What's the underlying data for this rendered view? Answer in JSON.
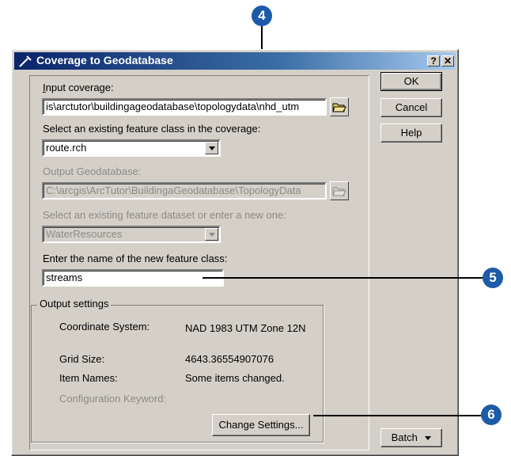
{
  "callouts": {
    "c4": "4",
    "c5": "5",
    "c6": "6"
  },
  "window": {
    "title": "Coverage to Geodatabase",
    "help_btn": "?",
    "close_btn": "✕"
  },
  "form": {
    "input_coverage_label_first": "I",
    "input_coverage_label_rest": "nput coverage:",
    "input_coverage_value": "is\\arctutor\\buildingageodatabase\\topologydata\\nhd_utm",
    "feature_class_label": "Select an existing feature class in the coverage:",
    "feature_class_value": "route.rch",
    "output_gdb_label": "Output Geodatabase:",
    "output_gdb_value": "C:\\arcgis\\ArcTutor\\BuildingaGeodatabase\\TopologyData",
    "feature_dataset_label": "Select an existing feature dataset or enter a new one:",
    "feature_dataset_value": "WaterResources",
    "new_fc_label": "Enter the name of the new feature class:",
    "new_fc_value": "streams"
  },
  "output_settings": {
    "group_label": "Output settings",
    "coord_system_key": "Coordinate System:",
    "coord_system_value": "NAD 1983 UTM Zone 12N",
    "grid_size_key": "Grid Size:",
    "grid_size_value": "4643.36554907076",
    "item_names_key": "Item Names:",
    "item_names_value": "Some items changed.",
    "config_keyword_key": "Configuration Keyword:",
    "change_settings_label": "Change Settings..."
  },
  "buttons": {
    "ok": "OK",
    "cancel": "Cancel",
    "help": "Help",
    "batch": "Batch"
  },
  "colors": {
    "title_start": "#0a246a",
    "title_end": "#a6caf0",
    "callout": "#1d5aa8",
    "face": "#d4d0c8"
  }
}
